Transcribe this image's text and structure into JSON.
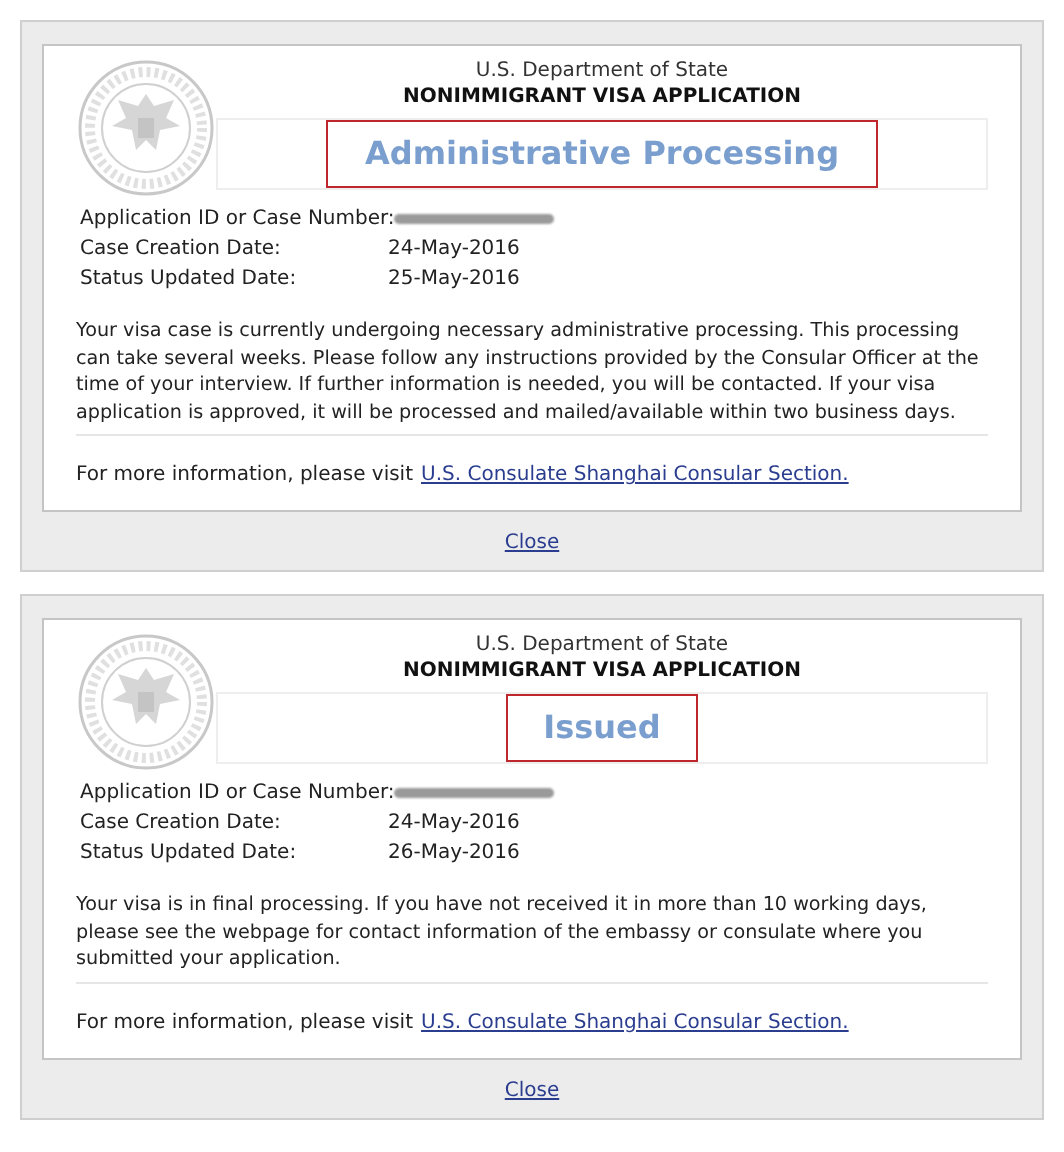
{
  "panels": [
    {
      "agency": "U.S. Department of State",
      "form_title": "NONIMMIGRANT VISA APPLICATION",
      "status": "Administrative Processing",
      "fields": [
        {
          "label": "Application ID or Case Number:",
          "redacted": true
        },
        {
          "label": "Case Creation Date:",
          "value": "24-May-2016"
        },
        {
          "label": "Status Updated Date:",
          "value": "25-May-2016"
        }
      ],
      "message": "Your visa case is currently undergoing necessary administrative processing. This processing can take several weeks. Please follow any instructions provided by the Consular Officer at the time of your interview. If further information is needed, you will be contacted. If your visa application is approved, it will be processed and mailed/available within two business days.",
      "more_info": {
        "text": "For more information, please visit",
        "link": "U.S. Consulate Shanghai Consular Section."
      },
      "close": "Close"
    },
    {
      "agency": "U.S. Department of State",
      "form_title": "NONIMMIGRANT VISA APPLICATION",
      "status": "Issued",
      "fields": [
        {
          "label": "Application ID or Case Number:",
          "redacted": true
        },
        {
          "label": "Case Creation Date:",
          "value": "24-May-2016"
        },
        {
          "label": "Status Updated Date:",
          "value": "26-May-2016"
        }
      ],
      "message": "Your visa is in final processing. If you have not received it in more than 10 working days, please see the webpage for contact information of the embassy or consulate where you submitted your application.",
      "more_info": {
        "text": "For more information, please visit",
        "link": "U.S. Consulate Shanghai Consular Section."
      },
      "close": "Close"
    }
  ]
}
